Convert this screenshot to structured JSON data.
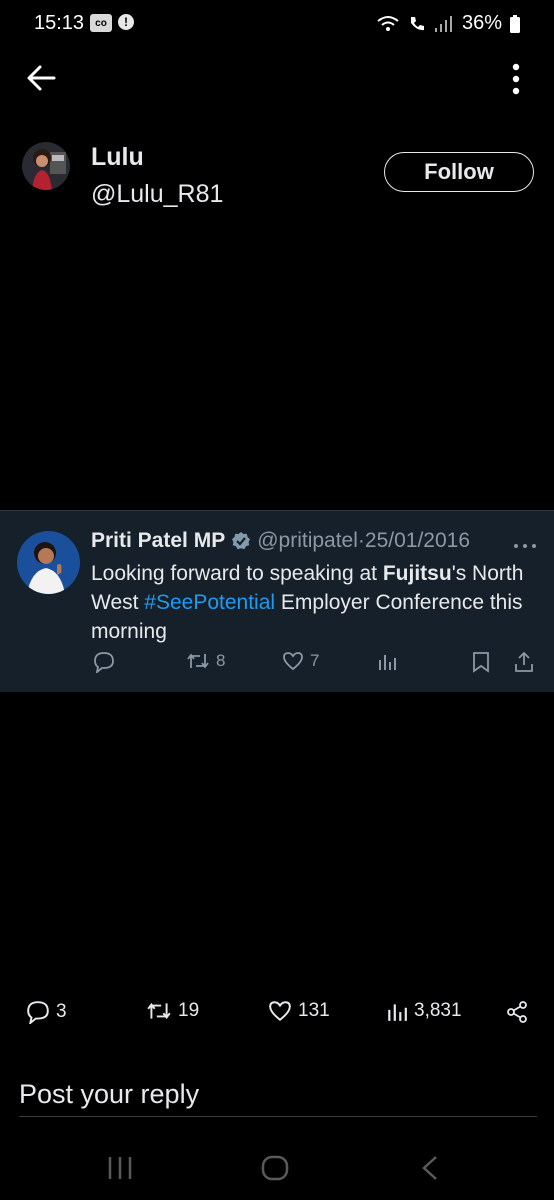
{
  "status_bar": {
    "time": "15:13",
    "box_label": "co",
    "alert_label": "!",
    "battery": "36%"
  },
  "profile": {
    "name": "Lulu",
    "handle": "@Lulu_R81",
    "follow_label": "Follow"
  },
  "quoted_tweet": {
    "name": "Priti Patel MP",
    "handle": "@pritipatel",
    "separator": "·",
    "date": "25/01/2016",
    "text_part1": "Looking forward to speaking at ",
    "text_bold": "Fujitsu",
    "text_part2": "'s North West ",
    "hashtag": "#SeePotential",
    "text_part3": " Employer Conference this morning",
    "retweets": "8",
    "likes": "7"
  },
  "stats": {
    "replies": "3",
    "reposts": "19",
    "likes": "131",
    "views": "3,831"
  },
  "reply": {
    "placeholder": "Post your reply"
  },
  "colors": {
    "background": "#000000",
    "card": "#15202b",
    "link": "#1d9bf0",
    "muted": "#8b98a5",
    "text": "#e7e9ea"
  },
  "icons": [
    "back-arrow-icon",
    "more-vertical-icon",
    "verified-badge-icon",
    "reply-icon",
    "retweet-icon",
    "like-icon",
    "views-icon",
    "bookmark-icon",
    "share-icon",
    "recents-icon",
    "home-icon",
    "nav-back-icon"
  ]
}
